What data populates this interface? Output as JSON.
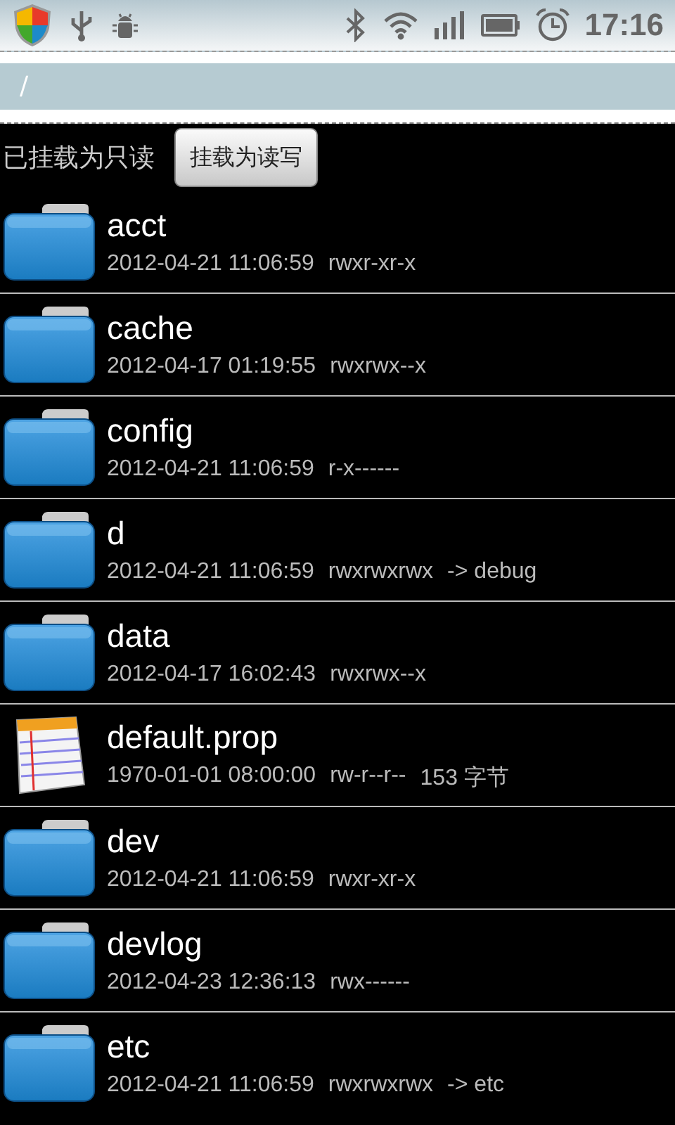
{
  "status_bar": {
    "time": "17:16"
  },
  "path_bar": {
    "path": "/"
  },
  "mount": {
    "status": "已挂载为只读",
    "button": "挂载为读写"
  },
  "files": [
    {
      "kind": "folder",
      "name": "acct",
      "modified": "2012-04-21 11:06:59",
      "permissions": "rwxr-xr-x"
    },
    {
      "kind": "folder",
      "name": "cache",
      "modified": "2012-04-17 01:19:55",
      "permissions": "rwxrwx--x"
    },
    {
      "kind": "folder",
      "name": "config",
      "modified": "2012-04-21 11:06:59",
      "permissions": "r-x------"
    },
    {
      "kind": "folder",
      "name": "d",
      "modified": "2012-04-21 11:06:59",
      "permissions": "rwxrwxrwx",
      "extra": "-> debug"
    },
    {
      "kind": "folder",
      "name": "data",
      "modified": "2012-04-17 16:02:43",
      "permissions": "rwxrwx--x"
    },
    {
      "kind": "file",
      "name": "default.prop",
      "modified": "1970-01-01 08:00:00",
      "permissions": "rw-r--r--",
      "extra": "153 字节"
    },
    {
      "kind": "folder",
      "name": "dev",
      "modified": "2012-04-21 11:06:59",
      "permissions": "rwxr-xr-x"
    },
    {
      "kind": "folder",
      "name": "devlog",
      "modified": "2012-04-23 12:36:13",
      "permissions": "rwx------"
    },
    {
      "kind": "folder",
      "name": "etc",
      "modified": "2012-04-21 11:06:59",
      "permissions": "rwxrwxrwx",
      "extra": "-> etc"
    }
  ]
}
